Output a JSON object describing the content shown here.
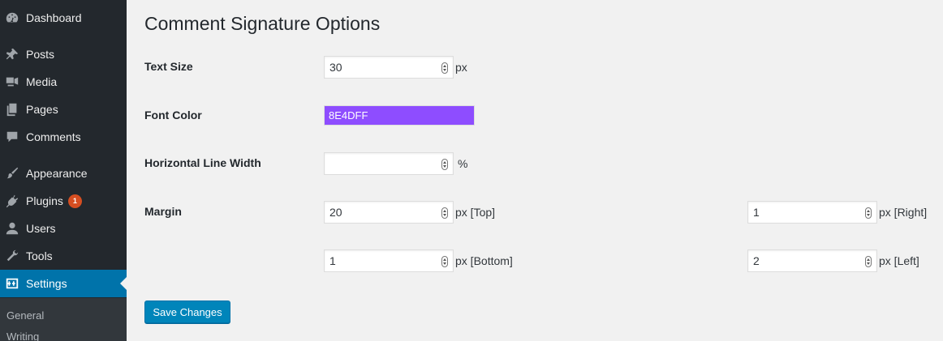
{
  "sidebar": {
    "items": [
      {
        "label": "Dashboard",
        "icon": "dashboard-icon"
      },
      {
        "label": "Posts",
        "icon": "pin-icon"
      },
      {
        "label": "Media",
        "icon": "media-icon"
      },
      {
        "label": "Pages",
        "icon": "pages-icon"
      },
      {
        "label": "Comments",
        "icon": "comment-icon"
      },
      {
        "label": "Appearance",
        "icon": "brush-icon"
      },
      {
        "label": "Plugins",
        "icon": "plug-icon",
        "badge": "1"
      },
      {
        "label": "Users",
        "icon": "user-icon"
      },
      {
        "label": "Tools",
        "icon": "wrench-icon"
      },
      {
        "label": "Settings",
        "icon": "settings-icon",
        "current": true
      }
    ],
    "submenu": [
      {
        "label": "General"
      },
      {
        "label": "Writing"
      }
    ]
  },
  "main": {
    "title": "Comment Signature Options",
    "text_size": {
      "label": "Text Size",
      "value": "30",
      "unit": "px"
    },
    "font_color": {
      "label": "Font Color",
      "value": "8E4DFF",
      "color": "#8e4dff"
    },
    "line_width": {
      "label": "Horizontal Line Width",
      "value": "",
      "unit": "%"
    },
    "margin": {
      "label": "Margin",
      "top": {
        "value": "20",
        "unit": "px [Top]"
      },
      "right": {
        "value": "1",
        "unit": "px [Right]"
      },
      "bottom": {
        "value": "1",
        "unit": "px [Bottom]"
      },
      "left": {
        "value": "2",
        "unit": "px [Left]"
      }
    },
    "save_label": "Save Changes"
  }
}
